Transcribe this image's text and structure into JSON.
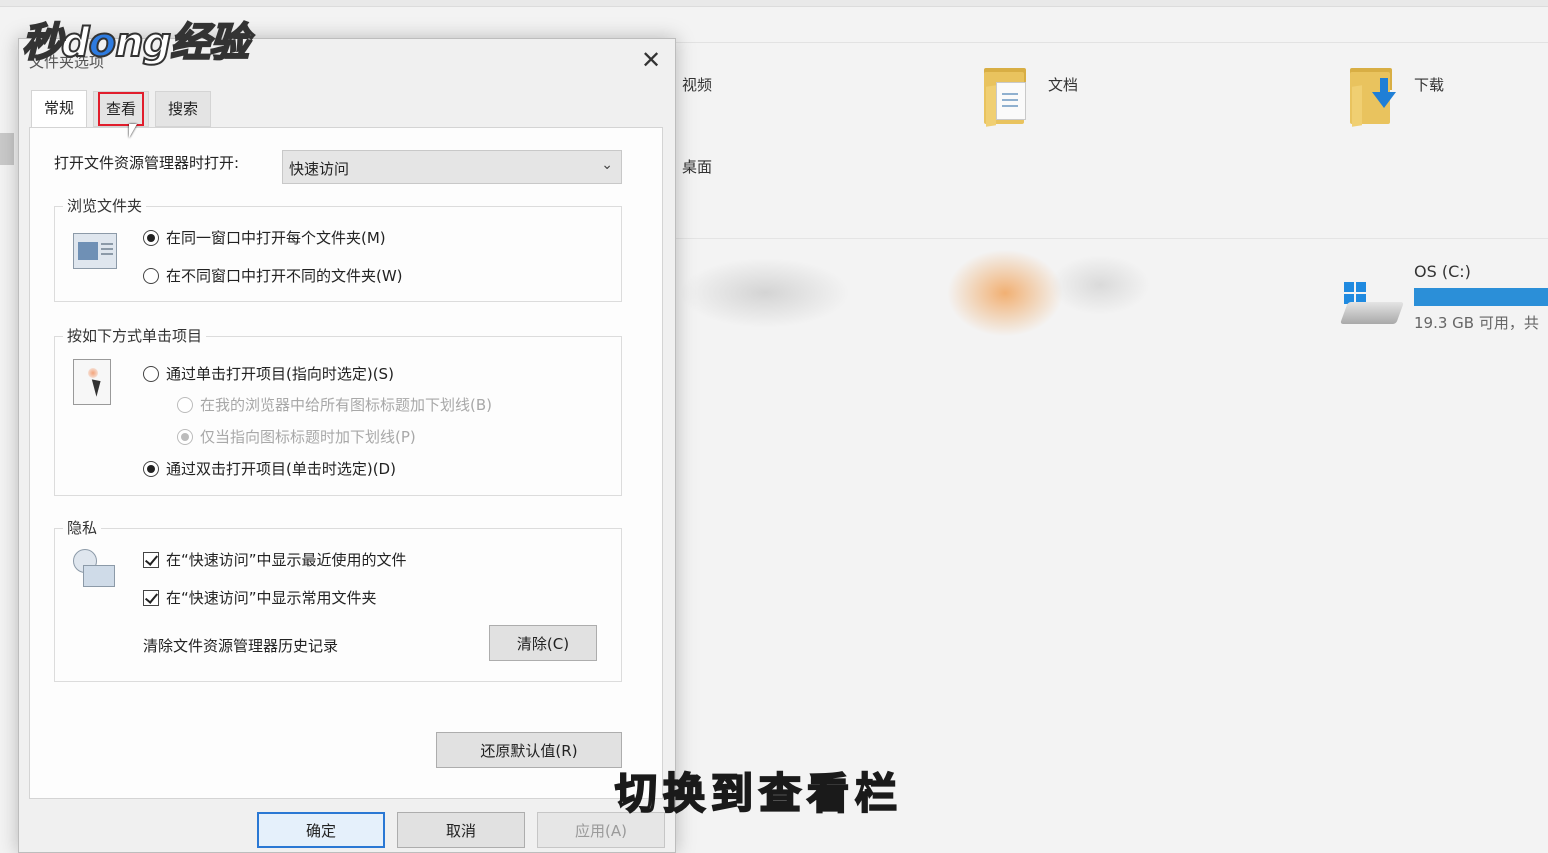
{
  "watermark": {
    "brand_prefix": "秒d",
    "brand_mid": "o",
    "brand_suffix": "ng经验"
  },
  "subtitle": "切换到查看栏",
  "explorer": {
    "folders": [
      {
        "label": "视频"
      },
      {
        "label": "文档"
      },
      {
        "label": "下载"
      },
      {
        "label": "桌面"
      }
    ],
    "drive": {
      "label": "OS (C:)",
      "free_text": "19.3 GB 可用，共"
    },
    "accent_color": "#2b8fd8"
  },
  "dialog": {
    "title": "文件夹选项",
    "close_glyph": "✕",
    "tabs": [
      {
        "label": "常规",
        "state": "active"
      },
      {
        "label": "查看",
        "state": "highlighted"
      },
      {
        "label": "搜索",
        "state": "normal"
      }
    ],
    "open_explorer_label": "打开文件资源管理器时打开:",
    "open_explorer_value": "快速访问",
    "browse": {
      "title": "浏览文件夹",
      "options": [
        {
          "label": "在同一窗口中打开每个文件夹(M)",
          "checked": true
        },
        {
          "label": "在不同窗口中打开不同的文件夹(W)",
          "checked": false
        }
      ]
    },
    "click": {
      "title": "按如下方式单击项目",
      "options": [
        {
          "label": "通过单击打开项目(指向时选定)(S)",
          "checked": false,
          "disabled": false
        },
        {
          "label": "在我的浏览器中给所有图标标题加下划线(B)",
          "checked": false,
          "disabled": true
        },
        {
          "label": "仅当指向图标标题时加下划线(P)",
          "checked": true,
          "disabled": true
        },
        {
          "label": "通过双击打开项目(单击时选定)(D)",
          "checked": true,
          "disabled": false
        }
      ]
    },
    "privacy": {
      "title": "隐私",
      "checks": [
        {
          "label": "在“快速访问”中显示最近使用的文件",
          "checked": true
        },
        {
          "label": "在“快速访问”中显示常用文件夹",
          "checked": true
        }
      ],
      "clear_history_label": "清除文件资源管理器历史记录",
      "clear_button": "清除(C)"
    },
    "restore_button": "还原默认值(R)",
    "ok_button": "确定",
    "cancel_button": "取消",
    "apply_button": "应用(A)",
    "highlight_color": "#e11d2c"
  }
}
